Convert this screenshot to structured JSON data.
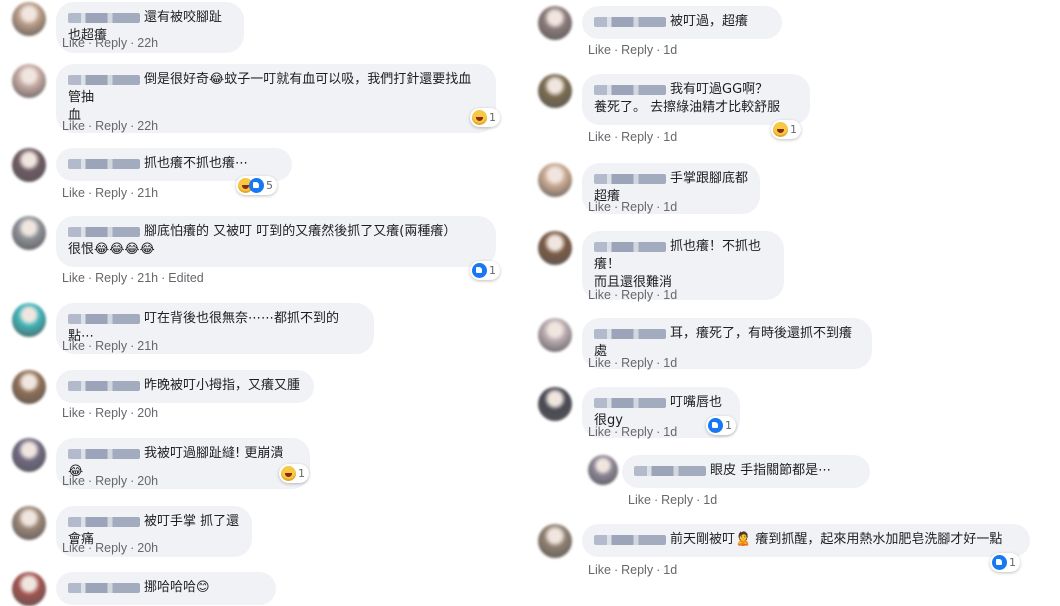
{
  "labels": {
    "like": "Like",
    "reply": "Reply",
    "sep": "·",
    "edited": "Edited"
  },
  "left": [
    {
      "text": "還有被咬腳趾也超癢",
      "time": "22h",
      "edited": false,
      "reaction": null,
      "avatar_color": "#b89a86"
    },
    {
      "text": "倒是很好奇😂蚊子一叮就有血可以吸，我們打針還要找血管抽\n血",
      "time": "22h",
      "edited": false,
      "reaction": {
        "icons": [
          "haha"
        ],
        "count": "1"
      },
      "avatar_color": "#c4a8a2"
    },
    {
      "text": "抓也癢不抓也癢⋯",
      "time": "21h",
      "edited": false,
      "reaction": {
        "icons": [
          "haha",
          "like"
        ],
        "count": "5"
      },
      "avatar_color": "#6d5a62"
    },
    {
      "text": "腳底怕癢的 又被叮 叮到的又癢然後抓了又癢(兩種癢）\n很恨😂😂😂😂",
      "time": "21h",
      "edited": true,
      "reaction": {
        "icons": [
          "like"
        ],
        "count": "1"
      },
      "avatar_color": "#8c8f96"
    },
    {
      "text": "叮在背後也很無奈⋯⋯都抓不到的點⋯",
      "time": "21h",
      "edited": false,
      "reaction": null,
      "avatar_color": "#3fb3b7"
    },
    {
      "text": "昨晚被叮小拇指，又癢又腫",
      "time": "20h",
      "edited": false,
      "reaction": null,
      "avatar_color": "#8e6e55"
    },
    {
      "text": "我被叮過腳趾縫! 更崩潰😂",
      "time": "20h",
      "edited": false,
      "reaction": {
        "icons": [
          "haha"
        ],
        "count": "1"
      },
      "avatar_color": "#6f6880"
    },
    {
      "text": "被叮手掌 抓了還會痛",
      "time": "20h",
      "edited": false,
      "reaction": null,
      "avatar_color": "#9a8576"
    },
    {
      "text": "挪哈哈哈😊",
      "time": "",
      "edited": false,
      "reaction": null,
      "avatar_color": "#a0524e"
    }
  ],
  "right": [
    {
      "text": "被叮過，超癢",
      "time": "1d",
      "reaction": null,
      "avatar_color": "#8b7a7a",
      "reply": false
    },
    {
      "text": "我有叮過GG啊？\n養死了。 去擦綠油精才比較舒服",
      "time": "1d",
      "reaction": {
        "icons": [
          "haha"
        ],
        "count": "1"
      },
      "avatar_color": "#7a6b4f",
      "reply": false
    },
    {
      "text": "手掌跟腳底都超癢",
      "time": "1d",
      "reaction": null,
      "avatar_color": "#c8a890",
      "reply": false
    },
    {
      "text": "抓也癢！不抓也癢！\n而且還很難消",
      "time": "1d",
      "reaction": null,
      "avatar_color": "#7a5a45",
      "reply": false
    },
    {
      "text": "耳，癢死了，有時後還抓不到癢處",
      "time": "1d",
      "reaction": null,
      "avatar_color": "#b8aab0",
      "reply": false
    },
    {
      "text": "叮嘴唇也很gy",
      "time": "1d",
      "reaction": {
        "icons": [
          "like"
        ],
        "count": "1"
      },
      "avatar_color": "#4a4a55",
      "reply": false
    },
    {
      "text": "眼皮 手指關節都是⋯",
      "time": "1d",
      "reaction": null,
      "avatar_color": "#8b8494",
      "reply": true
    },
    {
      "text": "前天剛被叮🙎 癢到抓醒，起來用熱水加肥皂洗腳才好一點",
      "time": "1d",
      "reaction": {
        "icons": [
          "like"
        ],
        "count": "1"
      },
      "avatar_color": "#8f8070",
      "reply": false
    }
  ]
}
